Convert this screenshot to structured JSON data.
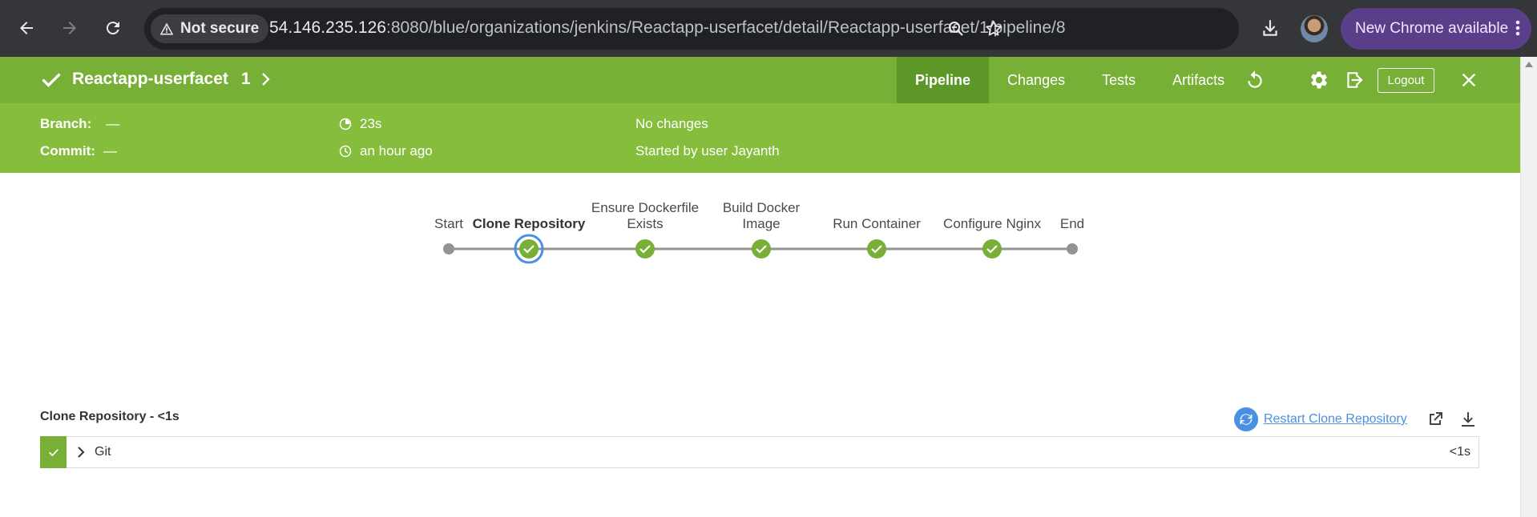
{
  "browser": {
    "back_icon": "arrow-left-icon",
    "forward_icon": "arrow-right-icon",
    "reload_icon": "reload-icon",
    "security_label": "Not secure",
    "url_host": "54.146.235.126",
    "url_rest": ":8080/blue/organizations/jenkins/Reactapp-userfacet/detail/Reactapp-userfacet/1/pipeline/8",
    "update_label": "New Chrome available"
  },
  "header": {
    "job_name": "Reactapp-userfacet",
    "run_number": "1",
    "status": "success",
    "tabs": [
      {
        "label": "Pipeline",
        "active": true
      },
      {
        "label": "Changes",
        "active": false
      },
      {
        "label": "Tests",
        "active": false
      },
      {
        "label": "Artifacts",
        "active": false
      }
    ],
    "logout_label": "Logout"
  },
  "summary": {
    "branch_label": "Branch:",
    "branch_value": "—",
    "commit_label": "Commit:",
    "commit_value": "—",
    "duration": "23s",
    "time_ago": "an hour ago",
    "changes": "No changes",
    "started_by": "Started by user Jayanth"
  },
  "pipeline": {
    "stages": [
      {
        "label": "Start",
        "kind": "terminal",
        "selected": false
      },
      {
        "label": "Clone Repository",
        "kind": "success",
        "selected": true
      },
      {
        "label": "Ensure Dockerfile\nExists",
        "kind": "success",
        "selected": false
      },
      {
        "label": "Build Docker\nImage",
        "kind": "success",
        "selected": false
      },
      {
        "label": "Run Container",
        "kind": "success",
        "selected": false
      },
      {
        "label": "Configure Nginx",
        "kind": "success",
        "selected": false
      },
      {
        "label": "End",
        "kind": "terminal",
        "selected": false
      }
    ]
  },
  "detail": {
    "title": "Clone Repository - <1s",
    "restart_label": "Restart Clone Repository",
    "steps": [
      {
        "name": "Git",
        "duration": "<1s",
        "status": "success"
      }
    ]
  },
  "colors": {
    "jenkins_green": "#78b037",
    "jenkins_green_dark": "#5c9728",
    "link_blue": "#4a90e2",
    "chrome_bg": "#35363a"
  }
}
